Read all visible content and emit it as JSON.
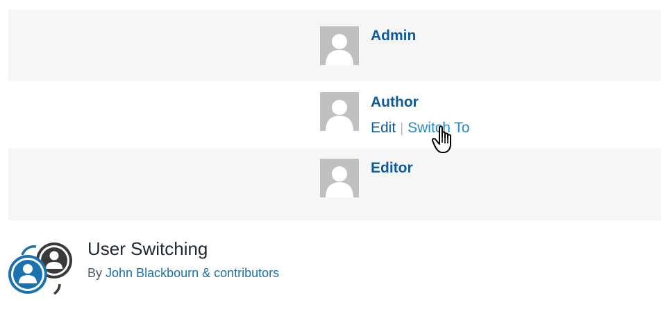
{
  "users": [
    {
      "name": "Admin"
    },
    {
      "name": "Author",
      "edit_label": "Edit",
      "separator": "|",
      "switch_label": "Switch To"
    },
    {
      "name": "Editor"
    }
  ],
  "plugin": {
    "title": "User Switching",
    "by_label": "By",
    "authors": "John Blackbourn & contributors"
  },
  "icons": {
    "avatar": "default-avatar-icon",
    "cursor": "hand-pointer-icon",
    "plugin": "user-switching-logo-icon"
  },
  "colors": {
    "link": "#0e5a9a",
    "link_hover": "#2388c4",
    "row_alt": "#f6f6f6",
    "avatar_bg": "#c0c0c0",
    "logo_blue": "#1a73ae"
  }
}
